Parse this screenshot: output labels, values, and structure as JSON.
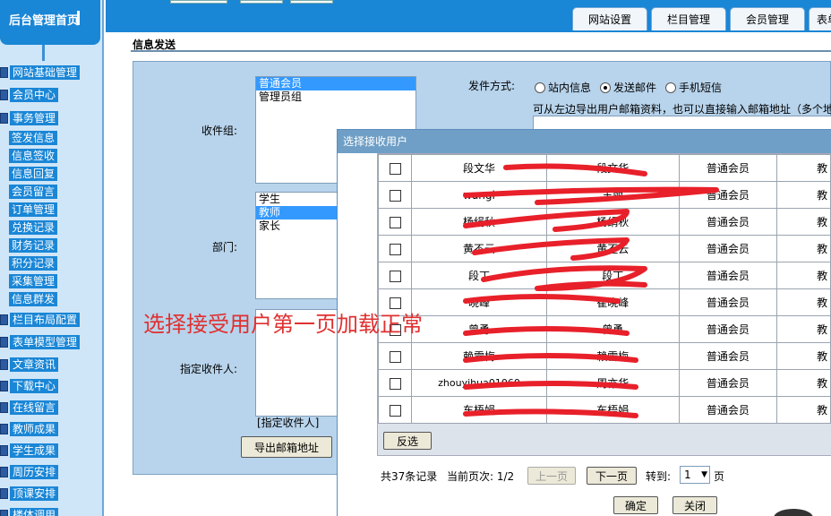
{
  "sidebar": {
    "title": "后台管理首页",
    "items": [
      {
        "label": "网站基础管理",
        "type": "group"
      },
      {
        "label": "会员中心",
        "type": "group"
      },
      {
        "label": "事务管理",
        "type": "group"
      },
      {
        "label": "签发信息",
        "type": "sub"
      },
      {
        "label": "信息签收",
        "type": "sub"
      },
      {
        "label": "信息回复",
        "type": "sub"
      },
      {
        "label": "会员留言",
        "type": "sub"
      },
      {
        "label": "订单管理",
        "type": "sub"
      },
      {
        "label": "兑换记录",
        "type": "sub"
      },
      {
        "label": "财务记录",
        "type": "sub"
      },
      {
        "label": "积分记录",
        "type": "sub"
      },
      {
        "label": "采集管理",
        "type": "sub"
      },
      {
        "label": "信息群发",
        "type": "sub"
      },
      {
        "label": "栏目布局配置",
        "type": "group"
      },
      {
        "label": "表单模型管理",
        "type": "group"
      },
      {
        "label": "文章资讯",
        "type": "group"
      },
      {
        "label": "下载中心",
        "type": "group"
      },
      {
        "label": "在线留言",
        "type": "group"
      },
      {
        "label": "教师成果",
        "type": "group"
      },
      {
        "label": "学生成果",
        "type": "group"
      },
      {
        "label": "周历安排",
        "type": "group"
      },
      {
        "label": "顶课安排",
        "type": "group"
      },
      {
        "label": "楼体调用",
        "type": "group"
      }
    ]
  },
  "tabs": [
    {
      "label": "网站设置"
    },
    {
      "label": "栏目管理"
    },
    {
      "label": "会员管理"
    },
    {
      "label": "表单"
    }
  ],
  "page": {
    "title": "信息发送",
    "recipient_group_label": "收件组:",
    "recipient_groups": [
      "普通会员",
      "管理员组"
    ],
    "department_label": "部门:",
    "departments": [
      "学生",
      "教师",
      "家长"
    ],
    "specified_label": "指定收件人:",
    "specified_caption": "[指定收件人]",
    "export_button": "导出邮箱地址",
    "send_method_label": "发件方式:",
    "send_methods": [
      "站内信息",
      "发送邮件",
      "手机短信"
    ],
    "selected_method": "发送邮件",
    "hint": "可从左边导出用户邮箱资料，也可以直接输入邮箱地址（多个地址"
  },
  "dialog": {
    "title": "选择接收用户",
    "rows": [
      {
        "col1": "段文华",
        "col2": "段文华",
        "group": "普通会员",
        "extra": "教"
      },
      {
        "col1": "wangl",
        "col2": "王丽",
        "group": "普通会员",
        "extra": "教"
      },
      {
        "col1": "杨绢秋",
        "col2": "杨绢秋",
        "group": "普通会员",
        "extra": "教"
      },
      {
        "col1": "黄丕云",
        "col2": "黄丕云",
        "group": "普通会员",
        "extra": "教"
      },
      {
        "col1": "段丁",
        "col2": "段丁",
        "group": "普通会员",
        "extra": "教"
      },
      {
        "col1": "晓峰",
        "col2": "崔晓峰",
        "group": "普通会员",
        "extra": "教"
      },
      {
        "col1": "曾勇",
        "col2": "曾勇",
        "group": "普通会员",
        "extra": "教"
      },
      {
        "col1": "赖雪梅",
        "col2": "赖雪梅",
        "group": "普通会员",
        "extra": "教"
      },
      {
        "col1": "zhouyihua01060",
        "col2": "周亦华",
        "group": "普通会员",
        "extra": "教"
      },
      {
        "col1": "车梧娟",
        "col2": "车梧娟",
        "group": "普通会员",
        "extra": "教"
      }
    ],
    "invert_button": "反选",
    "total": "共37条记录",
    "current_page": "当前页次: 1/2",
    "prev_button": "上一页",
    "next_button": "下一页",
    "goto_label": "转到:",
    "goto_value": "1",
    "page_unit": "页",
    "ok_button": "确定",
    "close_button": "关闭"
  },
  "annotation": "选择接受用户第一页加载正常",
  "colors": {
    "accent": "#1a86d6",
    "panel": "#b8d4ec",
    "selection": "#3399ff",
    "annotation": "#e03030"
  }
}
